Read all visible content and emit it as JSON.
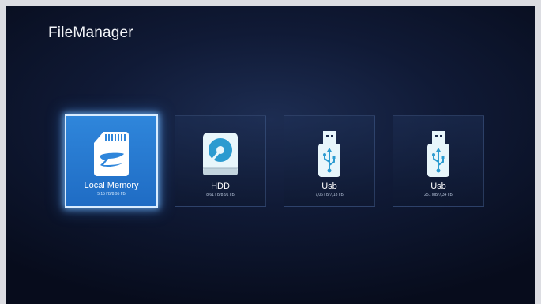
{
  "app": {
    "title": "FileManager"
  },
  "devices": [
    {
      "label": "Local Memory",
      "usage": "5,15 ГБ/8,95 ГБ",
      "icon": "sd-card-icon",
      "selected": true
    },
    {
      "label": "HDD",
      "usage": "8,61 ГБ/8,91 ГБ",
      "icon": "hdd-icon",
      "selected": false
    },
    {
      "label": "Usb",
      "usage": "7,06 ГБ/7,18 ГБ",
      "icon": "usb-icon",
      "selected": false
    },
    {
      "label": "Usb",
      "usage": "251 МБ/7,34 ГБ",
      "icon": "usb-icon",
      "selected": false
    }
  ],
  "colors": {
    "selected_tile": "#2f86db",
    "icon_fill": "#e8f6fb",
    "icon_accent": "#2c9bd0"
  }
}
